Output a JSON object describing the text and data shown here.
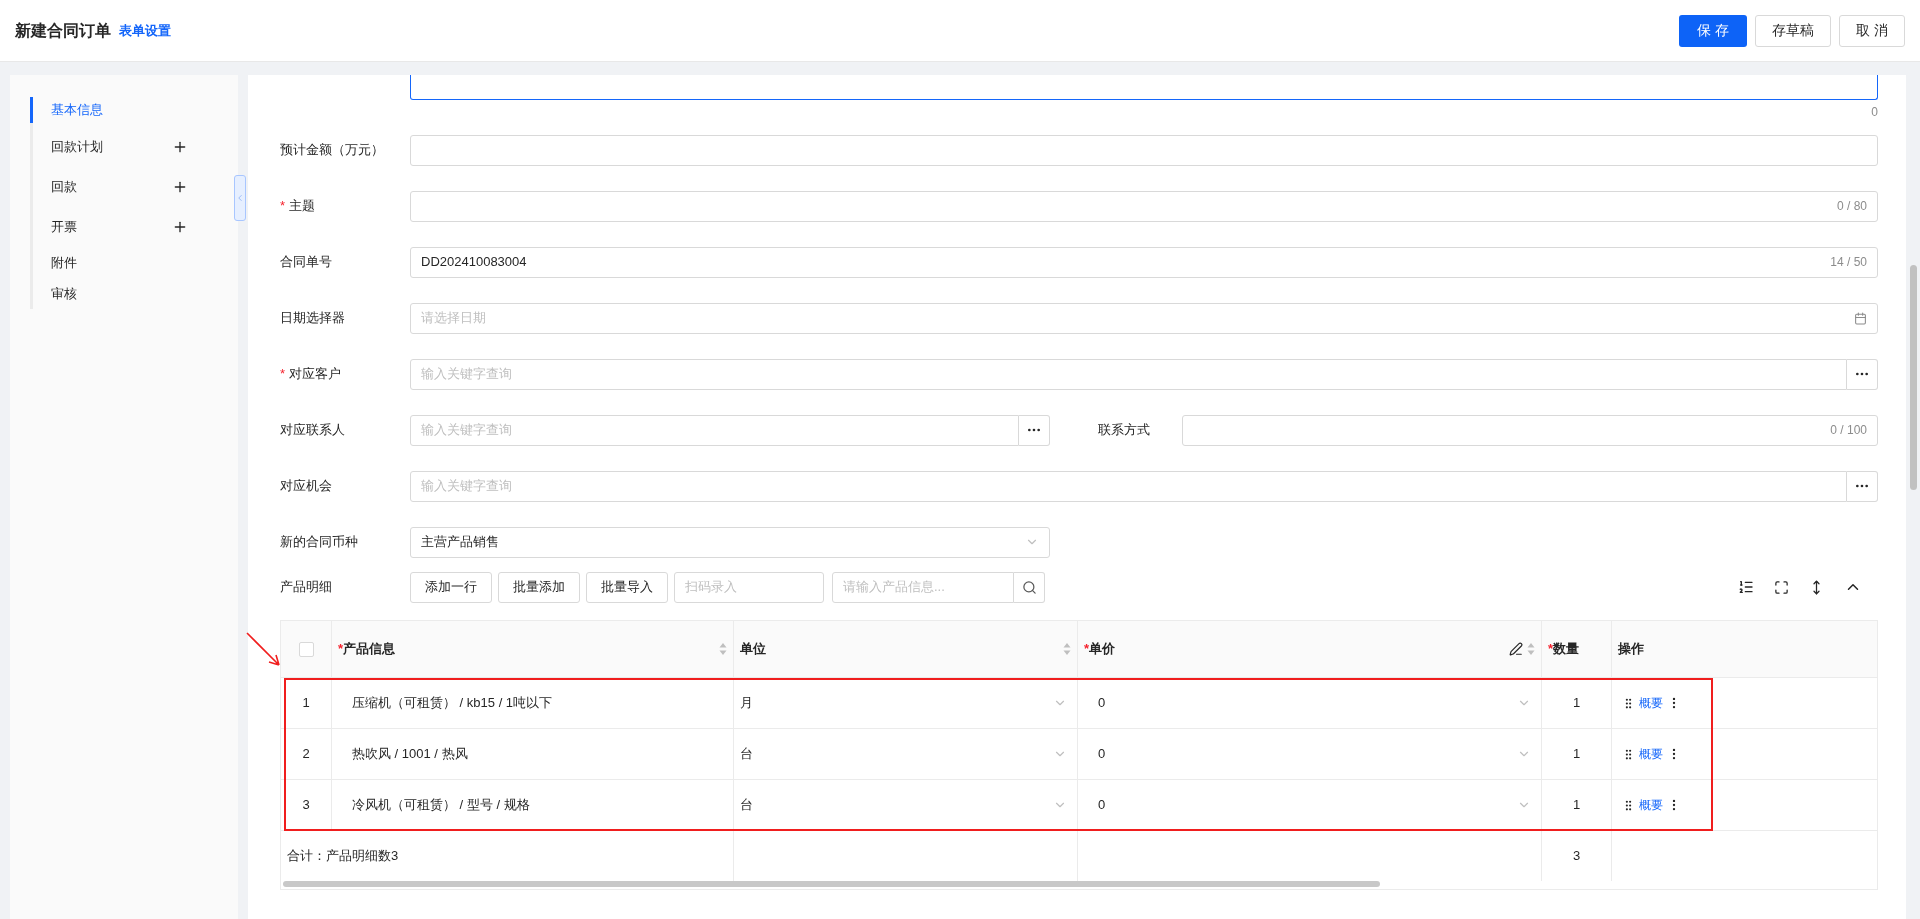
{
  "header": {
    "title": "新建合同订单",
    "settings_link": "表单设置",
    "buttons": [
      {
        "label": "保 存",
        "kind": "primary"
      },
      {
        "label": "存草稿",
        "kind": "default"
      },
      {
        "label": "取 消",
        "kind": "default"
      }
    ]
  },
  "sidebar": {
    "items": [
      {
        "label": "基本信息",
        "selected": true,
        "addable": false
      },
      {
        "label": "回款计划",
        "selected": false,
        "addable": true
      },
      {
        "label": "回款",
        "selected": false,
        "addable": true
      },
      {
        "label": "开票",
        "selected": false,
        "addable": true
      },
      {
        "label": "附件",
        "selected": false,
        "addable": false
      },
      {
        "label": "审核",
        "selected": false,
        "addable": false
      }
    ]
  },
  "form": {
    "textarea_counter": "0",
    "rows": [
      {
        "fields": [
          {
            "label": "预计金额（万元）",
            "kind": "text"
          }
        ]
      },
      {
        "fields": [
          {
            "mark": "*",
            "label": "主题",
            "kind": "text",
            "counter": "0 / 80"
          }
        ]
      },
      {
        "fields": [
          {
            "label": "合同单号",
            "kind": "text",
            "value": "DD202410083004",
            "counter": "14 / 50"
          }
        ]
      },
      {
        "fields": [
          {
            "label": "日期选择器",
            "kind": "date",
            "placeholder": "请选择日期"
          }
        ]
      },
      {
        "fields": [
          {
            "mark": "*",
            "label": "对应客户",
            "kind": "lookup",
            "placeholder": "输入关键字查询"
          }
        ]
      },
      {
        "fields": [
          {
            "label": "对应联系人",
            "kind": "lookup",
            "placeholder": "输入关键字查询"
          },
          {
            "label": "联系方式",
            "kind": "text",
            "counter": "0 / 100"
          }
        ]
      },
      {
        "fields": [
          {
            "label": "对应机会",
            "kind": "lookup",
            "placeholder": "输入关键字查询"
          }
        ]
      },
      {
        "fields": [
          {
            "label": "新的合同币种",
            "kind": "select",
            "value": "主营产品销售"
          }
        ]
      }
    ]
  },
  "products": {
    "label": "产品明细",
    "buttons": [
      "添加一行",
      "批量添加",
      "批量导入"
    ],
    "scan_placeholder": "扫码录入",
    "search_placeholder": "请输入产品信息...",
    "table": {
      "select_all": {
        "checked": false
      },
      "columns": [
        {
          "mark": "*",
          "label": "产品信息",
          "sortable": true,
          "editable": false
        },
        {
          "label": "单位",
          "sortable": true,
          "editable": false
        },
        {
          "mark": "*",
          "label": "单价",
          "sortable": true,
          "editable": true
        },
        {
          "mark": "*",
          "label": "数量",
          "sortable": false,
          "editable": false
        },
        {
          "label": "操作",
          "sortable": false,
          "editable": false
        }
      ],
      "rows": [
        {
          "index": "1",
          "product": "压缩机（可租赁） / kb15 / 1吨以下",
          "unit": "月",
          "price": "0",
          "quantity": "1",
          "action": "概要"
        },
        {
          "index": "2",
          "product": "热吹风 / 1001 / 热风",
          "unit": "台",
          "price": "0",
          "quantity": "1",
          "action": "概要"
        },
        {
          "index": "3",
          "product": "冷风机（可租赁） / 型号 / 规格",
          "unit": "台",
          "price": "0",
          "quantity": "1",
          "action": "概要"
        }
      ],
      "summary": {
        "label": "合计：产品明细数3",
        "quantity": "3"
      }
    }
  }
}
